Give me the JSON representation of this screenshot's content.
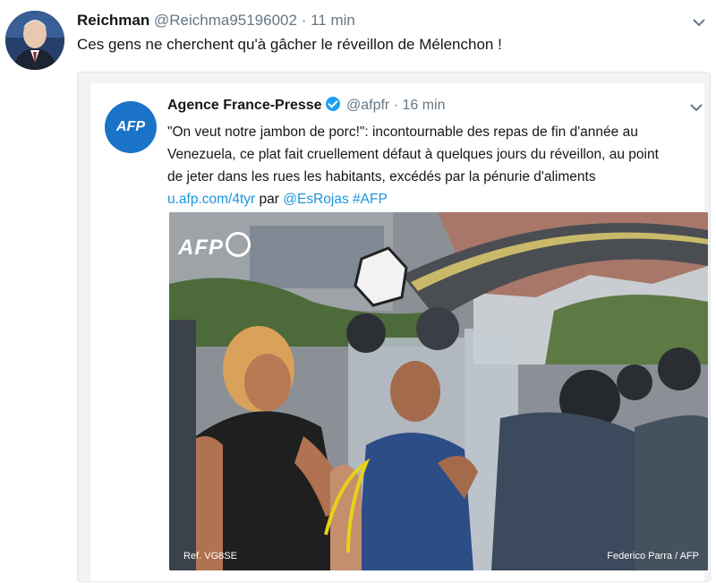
{
  "outer_tweet": {
    "author_name": "Reichman",
    "handle": "@Reichma95196002",
    "separator": "·",
    "time": "11 min",
    "text": "Ces gens ne cherchent qu'à gâcher le réveillon de Mélenchon !"
  },
  "quoted_tweet": {
    "author_name": "Agence France-Presse",
    "handle": "@afpfr",
    "separator": "·",
    "time": "16 min",
    "avatar_text": "AFP",
    "text_lines": [
      "\"On veut notre jambon de porc!\": incontournable des repas de fin d'année au",
      "Venezuela, ce plat fait cruellement défaut à quelques jours du réveillon, au point",
      "de jeter dans les rues les habitants, excédés par la pénurie d'aliments"
    ],
    "link": "u.afp.com/4tyr",
    "by_word": "par",
    "mention": "@EsRojas",
    "hashtag": "#AFP",
    "photo": {
      "watermark": "AFP",
      "credit_left": "Ref. VG8SE",
      "credit_right": "Federico Parra / AFP"
    }
  },
  "icons": [
    "chevron-down-icon",
    "verified-badge-icon"
  ],
  "colors": {
    "link": "#1b95e0",
    "verified": "#1da1f2",
    "afp_blue": "#1a73c7",
    "muted": "#657786"
  }
}
